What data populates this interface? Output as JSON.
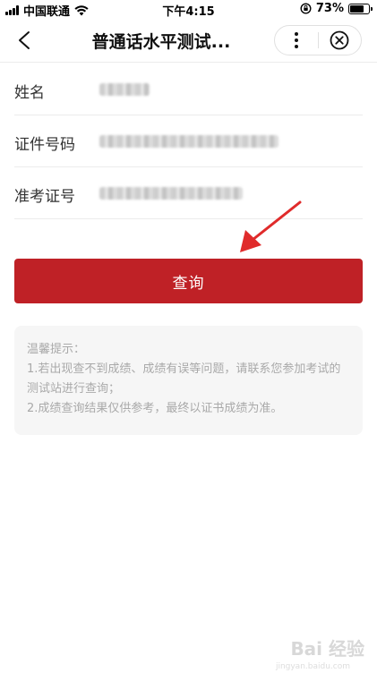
{
  "status_bar": {
    "carrier": "中国联通",
    "time": "下午4:15",
    "battery_text": "73%",
    "battery_level": 0.73,
    "icons": [
      "signal-icon",
      "wifi-icon",
      "orientation-lock-icon",
      "battery-icon"
    ]
  },
  "nav": {
    "title": "普通话水平测试...",
    "back_icon": "chevron-left-icon",
    "more_icon": "more-vertical-icon",
    "close_icon": "close-circle-icon"
  },
  "form": {
    "name_label": "姓名",
    "id_label": "证件号码",
    "ticket_label": "准考证号"
  },
  "query_button_label": "查询",
  "tips": {
    "title": "温馨提示：",
    "line1": "1.若出现查不到成绩、成绩有误等问题，请联系您参加考试的测试站进行查询；",
    "line2": "2.成绩查询结果仅供参考，最终以证书成绩为准。"
  },
  "watermark": {
    "text": "Bai 经验",
    "sub": "jingyan.baidu.com"
  },
  "colors": {
    "primary": "#bf2126",
    "arrow": "#e02b2b",
    "tips_bg": "#f6f6f6"
  }
}
